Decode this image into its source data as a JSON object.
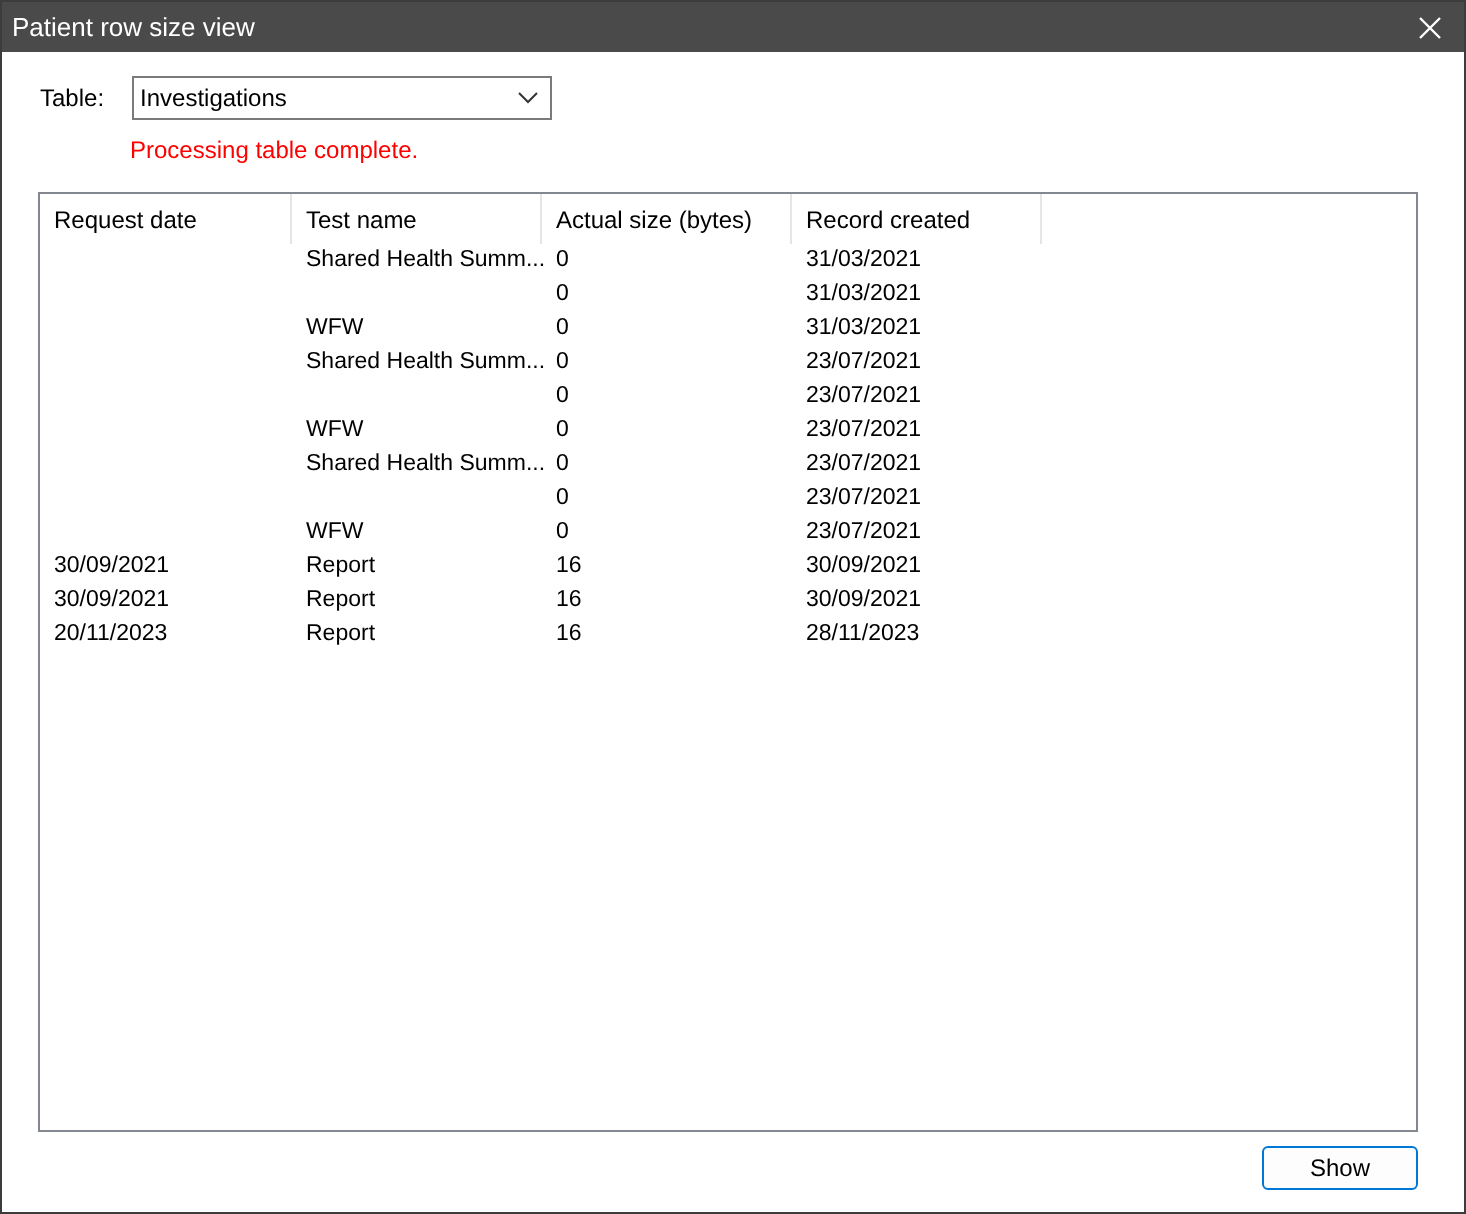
{
  "window": {
    "title": "Patient row size view"
  },
  "table_selector": {
    "label": "Table:",
    "value": "Investigations"
  },
  "status_message": "Processing table complete.",
  "table": {
    "columns": [
      "Request date",
      "Test name",
      "Actual size (bytes)",
      "Record created"
    ],
    "rows": [
      {
        "test_name": "Shared Health Summ...",
        "actual_size": "0",
        "record_created": "31/03/2021"
      },
      {
        "actual_size": "0",
        "record_created": "31/03/2021"
      },
      {
        "test_name": "WFW",
        "actual_size": "0",
        "record_created": "31/03/2021"
      },
      {
        "test_name": "Shared Health Summ...",
        "actual_size": "0",
        "record_created": "23/07/2021"
      },
      {
        "actual_size": "0",
        "record_created": "23/07/2021"
      },
      {
        "test_name": "WFW",
        "actual_size": "0",
        "record_created": "23/07/2021"
      },
      {
        "test_name": "Shared Health Summ...",
        "actual_size": "0",
        "record_created": "23/07/2021"
      },
      {
        "actual_size": "0",
        "record_created": "23/07/2021"
      },
      {
        "test_name": "WFW",
        "actual_size": "0",
        "record_created": "23/07/2021"
      },
      {
        "request_date": "30/09/2021",
        "test_name": "Report",
        "actual_size": "16",
        "record_created": "30/09/2021"
      },
      {
        "request_date": "30/09/2021",
        "test_name": "Report",
        "actual_size": "16",
        "record_created": "30/09/2021"
      },
      {
        "request_date": "20/11/2023",
        "test_name": "Report",
        "actual_size": "16",
        "record_created": "28/11/2023"
      }
    ]
  },
  "buttons": [
    "Show"
  ]
}
